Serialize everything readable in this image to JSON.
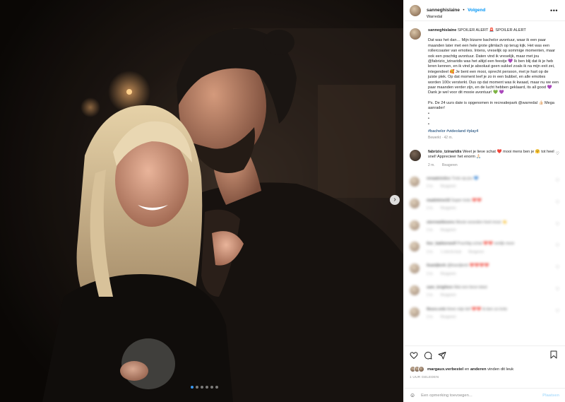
{
  "header": {
    "username": "sanneghislaine",
    "separator": "•",
    "follow_label": "Volgend",
    "location": "Warredal",
    "more_icon": "ellipsis-icon"
  },
  "caption": {
    "username": "sanneghislaine",
    "title": "SPOILER ALERT 🚨 SPOILER ALERT",
    "paragraph1": "Dat was het dan… Mijn bizarre bachelor avontuur, waar ik een paar maanden later met een hele grote glimlach op terug kijk. Het was een rollercoaster van emoties. Intens, vreselijk op sommige momenten, maar ook een prachtig avontuur. Daten vind ik vreselijk, maar met jou @fabrizio_tzinaridis was het altijd een feestje 💜 Ik ben blij dat ik je heb leren kennen, en ik vind je absoluut geen sukkel zoals ik na mijn exit zei, integendeel 🥰 Je bent een mooi, oprecht persoon, met je hart op de juiste plek. Op dat moment leef je zo in een bubbel, en alle emoties worden 100x versterkt. Dus op dat moment was ik kwaad, maar nu we een paar maanden verder zijn, en de lucht hebben geklaard, its all good 💜 Dank je wel voor dit mooie avontuur! 💚 💜",
    "paragraph2": "Ps. De 24 uurs date is opgenomen in recreatiepark @warredal 👍🏻 Mega aanrader!\n•\n•\n•",
    "hashtags": "#bachelor #videoland #play4",
    "edited": "Bewerkt · 42 m."
  },
  "comments": [
    {
      "username": "fabrizio_tzinaridis",
      "text": "Weet je lieve schat ❤️ mooi mens ben je 🤗 tot heel snel! Apprecieer het enorm 🙏🏻",
      "time": "2 m.",
      "reply": "Reageren"
    },
    {
      "username": "renaatvisitcc",
      "text": "Trots op jou 💙",
      "time": "2 m.",
      "reply": "Reageren"
    },
    {
      "username": "madeleine32",
      "text": "Super trots ❤️❤️",
      "time": "2 m.",
      "reply": "Reageren"
    },
    {
      "username": "sterrewitlovers",
      "text": "Mooie woorden heel mooi 👏",
      "time": "2 m.",
      "reply": "Reageren"
    },
    {
      "username": "ilse_bakkerwolf",
      "text": "Prachtig schat ❤️❤️ eerlijk mooi",
      "time": "2 m.",
      "reply": "Reageren",
      "extra": "1 vind-ik-leuk"
    },
    {
      "username": "lisanijkerk",
      "text": "@lisanijkerk ❤️❤️❤️❤️",
      "time": "2 m.",
      "reply": "Reageren"
    },
    {
      "username": "sam_brighton",
      "text": "Wat een lieve tekst",
      "time": "2 m.",
      "reply": "Reageren"
    },
    {
      "username": "fleurs.vnb",
      "text": "Heee mijn lief ❤️❤️ ik ben zo trots",
      "time": "2 m.",
      "reply": "Reageren"
    }
  ],
  "actions": {
    "like_icon": "heart-icon",
    "comment_icon": "comment-icon",
    "share_icon": "share-icon",
    "save_icon": "bookmark-icon"
  },
  "likes": {
    "user": "margaux.verbestel",
    "connector": "en",
    "others": "anderen",
    "suffix": "vinden dit leuk"
  },
  "date": "1 UUR GELEDEN",
  "add_comment": {
    "emoji_icon": "smiley-icon",
    "placeholder": "Een opmerking toevoegen...",
    "post_label": "Plaatsen"
  },
  "carousel": {
    "total": 6,
    "active": 1,
    "next_icon": "chevron-right-icon"
  },
  "colors": {
    "link": "#0095f6",
    "muted": "#8e8e8e",
    "text": "#262626"
  }
}
